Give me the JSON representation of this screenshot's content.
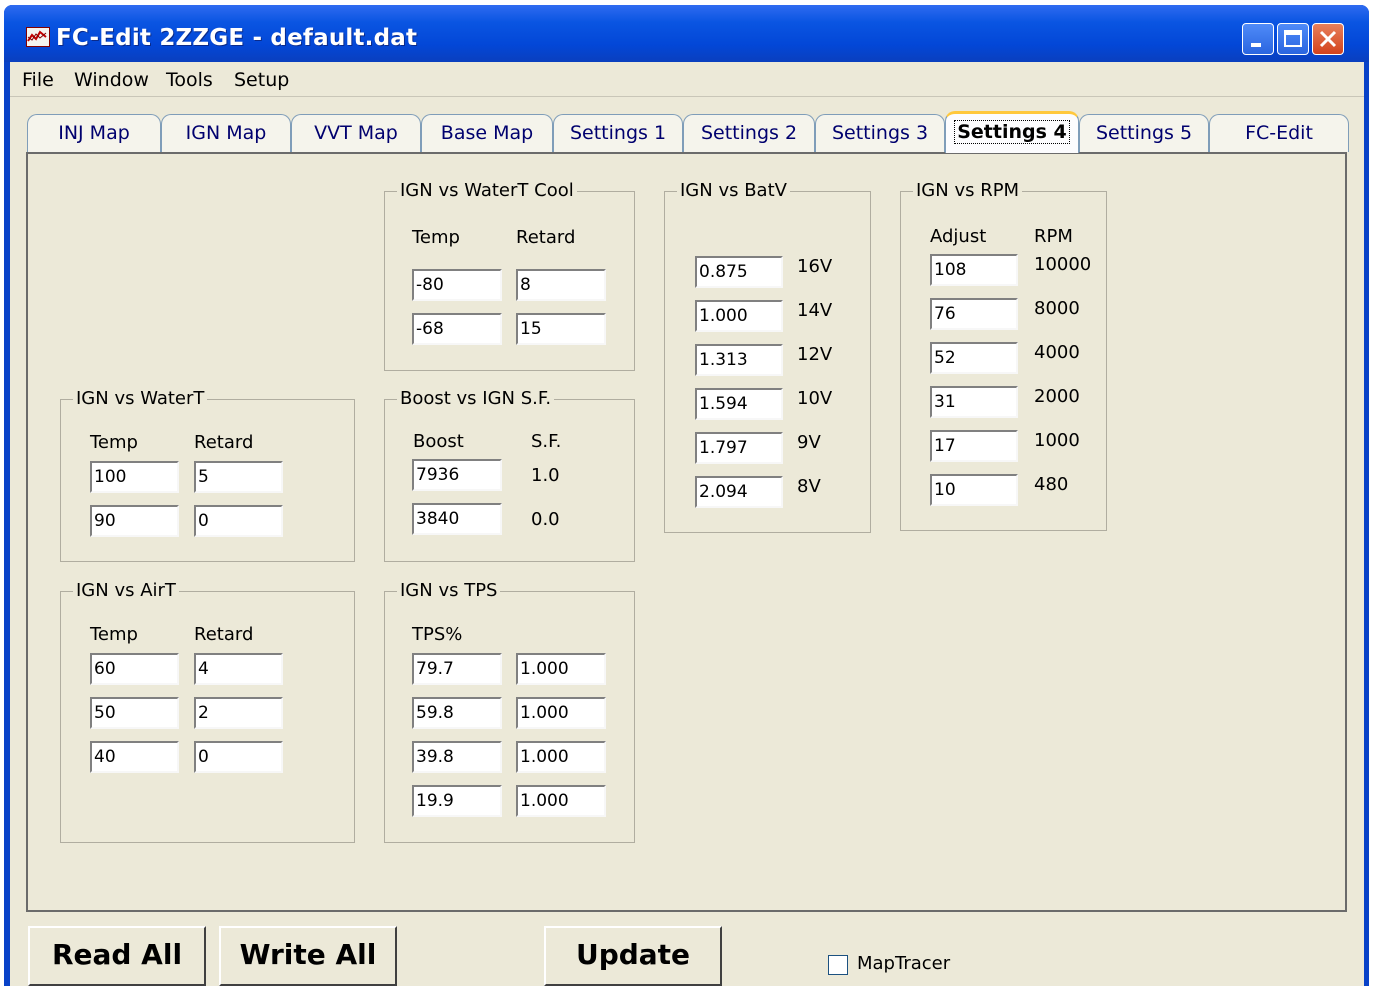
{
  "window": {
    "title": "FC-Edit 2ZZGE - default.dat"
  },
  "menu": [
    "File",
    "Window",
    "Tools",
    "Setup"
  ],
  "tabs": [
    "INJ Map",
    "IGN Map",
    "VVT Map",
    "Base Map",
    "Settings 1",
    "Settings 2",
    "Settings 3",
    "Settings 4",
    "Settings 5",
    "FC-Edit"
  ],
  "active_tab": "Settings 4",
  "water_cool": {
    "title": "IGN vs WaterT Cool",
    "col1": "Temp",
    "col2": "Retard",
    "rows": [
      {
        "a": "-80",
        "b": "8"
      },
      {
        "a": "-68",
        "b": "15"
      }
    ]
  },
  "batv": {
    "title": "IGN vs BatV",
    "rows": [
      {
        "v": "0.875",
        "l": "16V"
      },
      {
        "v": "1.000",
        "l": "14V"
      },
      {
        "v": "1.313",
        "l": "12V"
      },
      {
        "v": "1.594",
        "l": "10V"
      },
      {
        "v": "1.797",
        "l": "9V"
      },
      {
        "v": "2.094",
        "l": "8V"
      }
    ]
  },
  "rpm": {
    "title": "IGN vs RPM",
    "col1": "Adjust",
    "col2": "RPM",
    "rows": [
      {
        "v": "108",
        "l": "10000"
      },
      {
        "v": "76",
        "l": "8000"
      },
      {
        "v": "52",
        "l": "4000"
      },
      {
        "v": "31",
        "l": "2000"
      },
      {
        "v": "17",
        "l": "1000"
      },
      {
        "v": "10",
        "l": "480"
      }
    ]
  },
  "watert": {
    "title": "IGN vs WaterT",
    "col1": "Temp",
    "col2": "Retard",
    "rows": [
      {
        "a": "100",
        "b": "5"
      },
      {
        "a": "90",
        "b": "0"
      }
    ]
  },
  "boost": {
    "title": "Boost vs IGN S.F.",
    "col1": "Boost",
    "col2": "S.F.",
    "rows": [
      {
        "v": "7936",
        "l": "1.0"
      },
      {
        "v": "3840",
        "l": "0.0"
      }
    ]
  },
  "airt": {
    "title": "IGN vs AirT",
    "col1": "Temp",
    "col2": "Retard",
    "rows": [
      {
        "a": "60",
        "b": "4"
      },
      {
        "a": "50",
        "b": "2"
      },
      {
        "a": "40",
        "b": "0"
      }
    ]
  },
  "tps": {
    "title": "IGN vs TPS",
    "col1": "TPS%",
    "rows": [
      {
        "a": "79.7",
        "b": "1.000"
      },
      {
        "a": "59.8",
        "b": "1.000"
      },
      {
        "a": "39.8",
        "b": "1.000"
      },
      {
        "a": "19.9",
        "b": "1.000"
      }
    ]
  },
  "buttons": {
    "read_all": "Read All",
    "write_all": "Write All",
    "update": "Update"
  },
  "maptracer": {
    "label": "MapTracer",
    "checked": false
  }
}
